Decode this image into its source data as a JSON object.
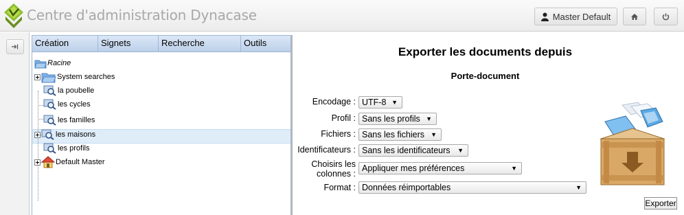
{
  "header": {
    "title": "Centre d'administration Dynacase",
    "user_label": "Master Default",
    "home_icon": "home-icon",
    "power_icon": "power-icon"
  },
  "tree_panel": {
    "menu": [
      {
        "label": "Création"
      },
      {
        "label": "Signets"
      },
      {
        "label": "Recherche"
      },
      {
        "label": "Outils"
      }
    ],
    "nodes": [
      {
        "label": "Racine",
        "icon": "folder-icon"
      },
      {
        "label": "System searches",
        "icon": "folder-icon"
      },
      {
        "label": "la poubelle",
        "icon": "search-icon"
      },
      {
        "label": "les cycles",
        "icon": "search-icon"
      },
      {
        "label": "les familles",
        "icon": "search-icon"
      },
      {
        "label": "les maisons",
        "icon": "search-icon"
      },
      {
        "label": "les profils",
        "icon": "search-icon"
      },
      {
        "label": "Default Master",
        "icon": "house-icon"
      }
    ],
    "selected": "les familles"
  },
  "export_form": {
    "title": "Exporter les documents depuis",
    "subtitle": "Porte-document",
    "fields": {
      "encodage": {
        "label": "Encodage :",
        "value": "UTF-8"
      },
      "profil": {
        "label": "Profil :",
        "value": "Sans les profils"
      },
      "fichiers": {
        "label": "Fichiers :",
        "value": "Sans les fichiers"
      },
      "identificateurs": {
        "label": "Identificateurs :",
        "value": "Sans les identificateurs"
      },
      "colonnes": {
        "label_line1": "Choisirs les",
        "label_line2": "colonnes :",
        "value": "Appliquer mes préférences"
      },
      "format": {
        "label": "Format :",
        "value": "Données réimportables"
      }
    },
    "export_button": "Exporter"
  },
  "colors": {
    "menubar": "#c7d8ee",
    "selection": "#dfedf9",
    "title_gray": "#a8a8a8"
  }
}
